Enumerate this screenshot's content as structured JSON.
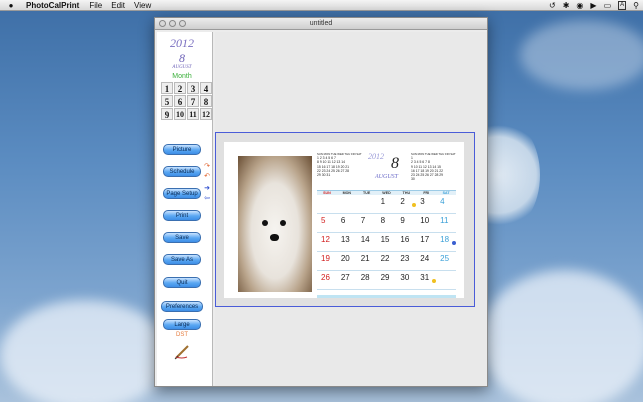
{
  "menubar": {
    "apple": "",
    "app_name": "PhotoCalPrint",
    "items": [
      "File",
      "Edit",
      "View"
    ],
    "status_icons": [
      "time-machine-icon",
      "bluetooth-icon",
      "wifi-icon",
      "volume-icon",
      "battery-icon",
      "input-menu-icon",
      "spotlight-icon"
    ],
    "input_menu": "A"
  },
  "window": {
    "title": "untitled"
  },
  "sidebar": {
    "year": "2012",
    "month_number": "8",
    "month_name": "AUGUST",
    "month_label": "Month",
    "months": [
      "1",
      "2",
      "3",
      "4",
      "5",
      "6",
      "7",
      "8",
      "9",
      "10",
      "11",
      "12"
    ],
    "buttons": {
      "picture": "Picture",
      "schedule": "Schedule",
      "page_setup": "Page Setup",
      "print": "Print",
      "save": "Save",
      "save_as": "Save As",
      "quit": "Quit",
      "preferences": "Preferences",
      "large": "Large"
    },
    "dst": "DST"
  },
  "calendar": {
    "year": "2012",
    "month_number": "8",
    "month_name": "AUGUST",
    "weekdays": [
      "SUN",
      "MON",
      "TUE",
      "WED",
      "THU",
      "FRI",
      "SAT"
    ],
    "prev_mini": {
      "header": "SUN MON TUE WED THU FRI SAT",
      "rows": [
        "1 2 3 4 5 6 7",
        "8 9 10 11 12 13 14",
        "15 16 17 18 19 20 21",
        "22 23 24 25 26 27 28",
        "29 30 31"
      ]
    },
    "next_mini": {
      "header": "SUN MON TUE WED THU FRI SAT",
      "rows": [
        "1",
        "2 3 4 5 6 7 8",
        "9 10 11 12 13 14 15",
        "16 17 18 19 20 21 22",
        "23 24 25 26 27 28 29",
        "30"
      ]
    },
    "weeks": [
      [
        "",
        "",
        "",
        "1",
        "2",
        "3",
        "4"
      ],
      [
        "5",
        "6",
        "7",
        "8",
        "9",
        "10",
        "11"
      ],
      [
        "12",
        "13",
        "14",
        "15",
        "16",
        "17",
        "18"
      ],
      [
        "19",
        "20",
        "21",
        "22",
        "23",
        "24",
        "25"
      ],
      [
        "26",
        "27",
        "28",
        "29",
        "30",
        "31",
        ""
      ]
    ],
    "marker_color": "#f0c020",
    "marker_blue": "#3a5fd0"
  }
}
